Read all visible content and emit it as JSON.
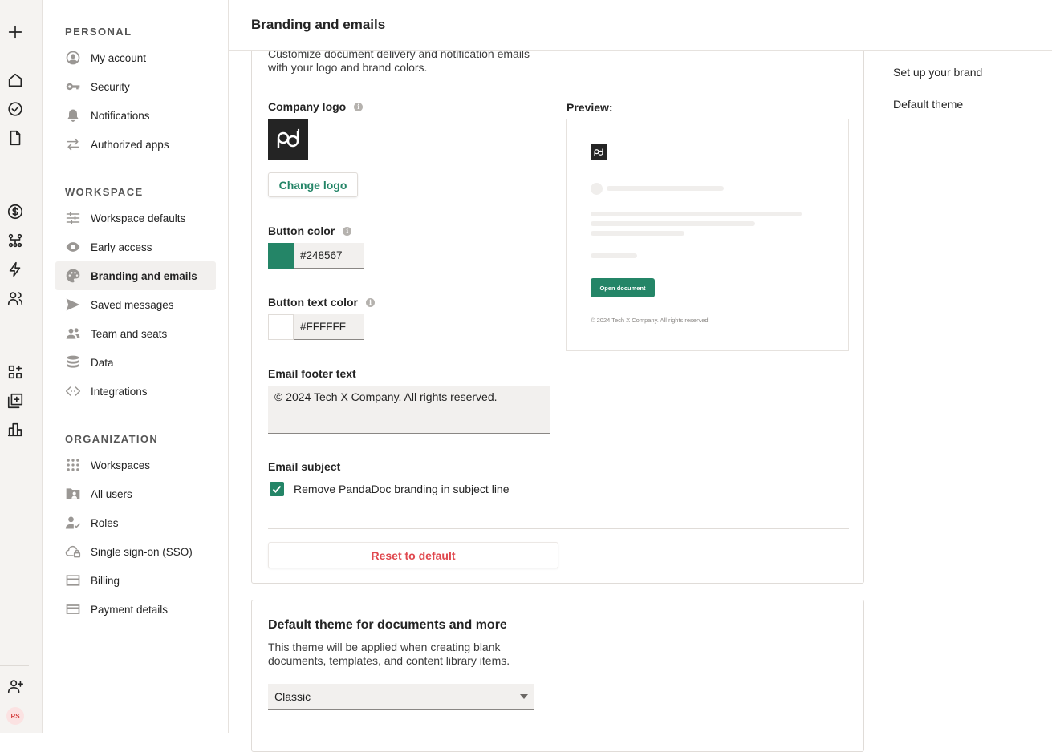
{
  "rail": {
    "avatar_initials": "RS"
  },
  "nav": {
    "sections": [
      {
        "heading": "PERSONAL",
        "items": [
          {
            "label": "My account",
            "icon": "user-circle-icon"
          },
          {
            "label": "Security",
            "icon": "key-icon"
          },
          {
            "label": "Notifications",
            "icon": "bell-icon"
          },
          {
            "label": "Authorized apps",
            "icon": "arrows-swap-icon"
          }
        ]
      },
      {
        "heading": "WORKSPACE",
        "items": [
          {
            "label": "Workspace defaults",
            "icon": "sliders-icon"
          },
          {
            "label": "Early access",
            "icon": "eye-icon"
          },
          {
            "label": "Branding and emails",
            "icon": "palette-icon",
            "active": true
          },
          {
            "label": "Saved messages",
            "icon": "send-icon"
          },
          {
            "label": "Team and seats",
            "icon": "team-icon"
          },
          {
            "label": "Data",
            "icon": "database-icon"
          },
          {
            "label": "Integrations",
            "icon": "code-icon"
          }
        ]
      },
      {
        "heading": "ORGANIZATION",
        "items": [
          {
            "label": "Workspaces",
            "icon": "grid-dots-icon"
          },
          {
            "label": "All users",
            "icon": "folder-user-icon"
          },
          {
            "label": "Roles",
            "icon": "user-check-icon"
          },
          {
            "label": "Single sign-on (SSO)",
            "icon": "cloud-lock-icon"
          },
          {
            "label": "Billing",
            "icon": "invoice-icon"
          },
          {
            "label": "Payment details",
            "icon": "credit-card-icon"
          }
        ]
      }
    ]
  },
  "header": {
    "title": "Branding and emails"
  },
  "branding": {
    "description": "Customize document delivery and notification emails with your logo and brand colors.",
    "company_logo_label": "Company logo",
    "change_logo_label": "Change logo",
    "button_color_label": "Button color",
    "button_color_value": "#248567",
    "button_text_color_label": "Button text color",
    "button_text_color_value": "#FFFFFF",
    "footer_label": "Email footer text",
    "footer_value": "© 2024 Tech X Company. All rights reserved.",
    "subject_label": "Email subject",
    "subject_checkbox_label": "Remove PandaDoc branding in subject line",
    "subject_checked": true,
    "reset_label": "Reset to default",
    "preview_label": "Preview:",
    "preview_button_label": "Open document",
    "preview_footer": "© 2024 Tech X Company. All rights reserved."
  },
  "theme": {
    "title": "Default theme for documents and more",
    "description": "This theme will be applied when creating blank documents, templates, and content library items.",
    "selected": "Classic"
  },
  "toc": {
    "items": [
      "Set up your brand",
      "Default theme"
    ]
  },
  "colors": {
    "accent": "#248567",
    "danger": "#e0484e"
  }
}
